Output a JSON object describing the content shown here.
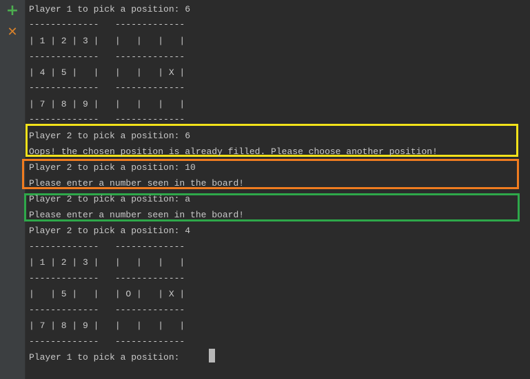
{
  "gutter": {
    "add_glyph": "+",
    "add_icon": "plus-icon",
    "close_glyph": "✕",
    "close_icon": "close-icon"
  },
  "console": {
    "lines": [
      "Player 1 to pick a position: 6",
      "-------------   -------------",
      "| 1 | 2 | 3 |   |   |   |   |",
      "-------------   -------------",
      "| 4 | 5 |   |   |   |   | X |",
      "-------------   -------------",
      "| 7 | 8 | 9 |   |   |   |   |",
      "-------------   -------------",
      "Player 2 to pick a position: 6",
      "Oops! the chosen position is already filled. Please choose another position!",
      "Player 2 to pick a position: 10",
      "Please enter a number seen in the board!",
      "Player 2 to pick a position: a",
      "Please enter a number seen in the board!",
      "Player 2 to pick a position: 4",
      "-------------   -------------",
      "| 1 | 2 | 3 |   |   |   |   |",
      "-------------   -------------",
      "|   | 5 |   |   | O |   | X |",
      "-------------   -------------",
      "| 7 | 8 | 9 |   |   |   |   |",
      "-------------   -------------",
      "Player 1 to pick a position: "
    ]
  },
  "highlights": {
    "yellow": "#f2e21a",
    "orange": "#f07c1f",
    "green": "#2ea84a"
  },
  "colors": {
    "background": "#2b2b2b",
    "text": "#c9c9c9",
    "gutter": "#3c3f41"
  }
}
